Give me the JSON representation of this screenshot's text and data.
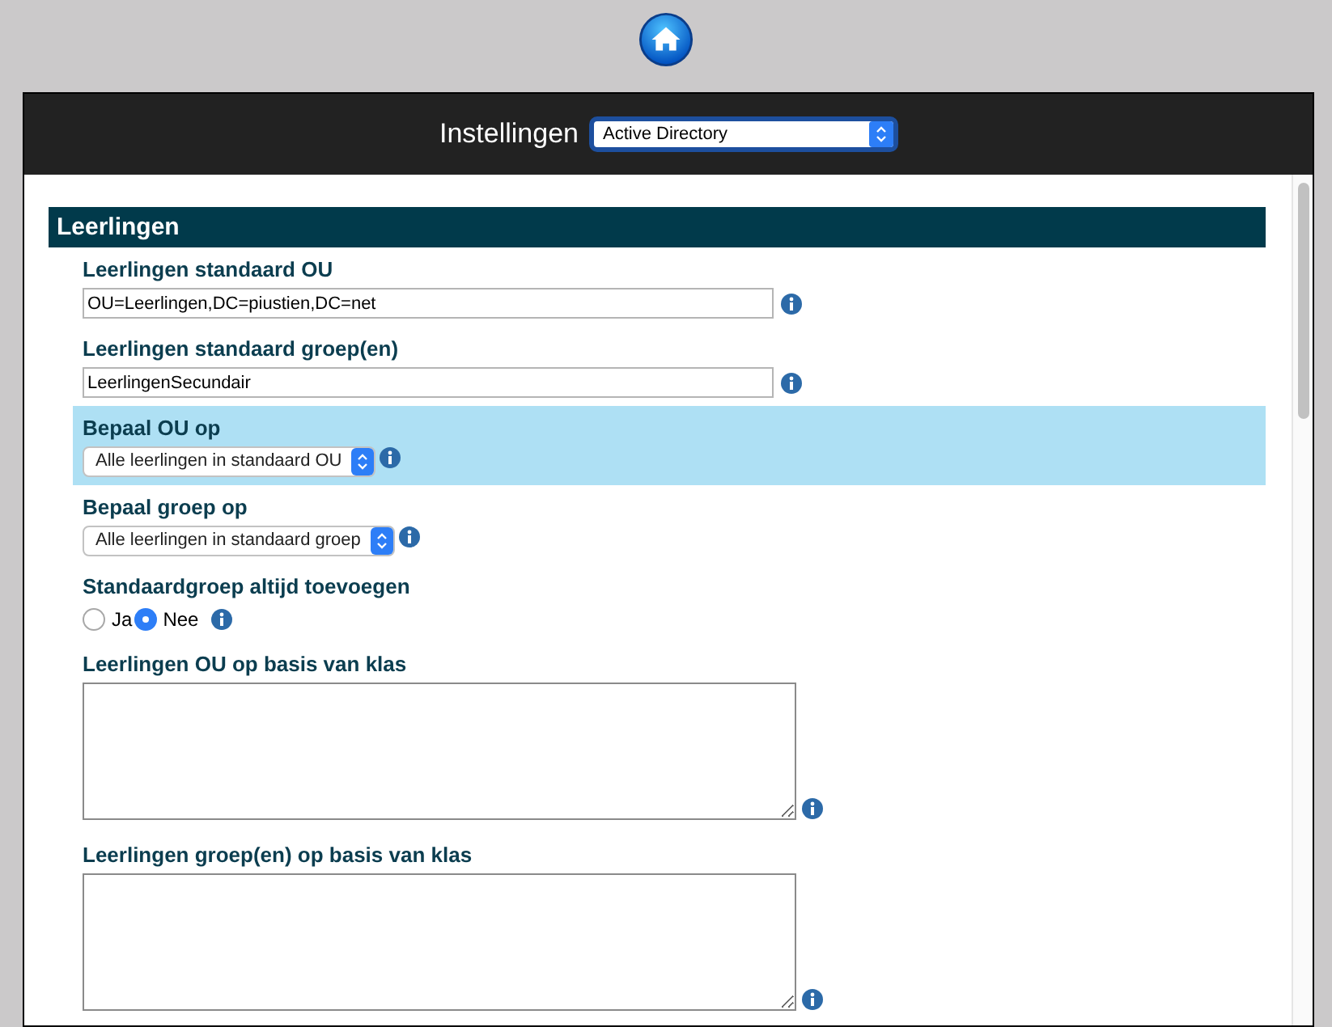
{
  "header": {
    "title": "Instellingen",
    "select_value": "Active Directory"
  },
  "section": {
    "title": "Leerlingen"
  },
  "fields": [
    {
      "kind": "text",
      "label": "Leerlingen standaard OU",
      "value": "OU=Leerlingen,DC=piustien,DC=net",
      "highlighted": false
    },
    {
      "kind": "text",
      "label": "Leerlingen standaard groep(en)",
      "value": "LeerlingenSecundair",
      "highlighted": false
    },
    {
      "kind": "select",
      "label": "Bepaal OU op",
      "value": "Alle leerlingen in standaard OU",
      "highlighted": true
    },
    {
      "kind": "select",
      "label": "Bepaal groep op",
      "value": "Alle leerlingen in standaard groep",
      "highlighted": false
    },
    {
      "kind": "radio",
      "label": "Standaardgroep altijd toevoegen",
      "highlighted": false,
      "options": [
        {
          "label": "Ja",
          "selected": false
        },
        {
          "label": "Nee",
          "selected": true
        }
      ]
    },
    {
      "kind": "textarea",
      "label": "Leerlingen OU op basis van klas",
      "highlighted": false
    },
    {
      "kind": "textarea",
      "label": "Leerlingen groep(en) op basis van klas",
      "highlighted": false
    }
  ]
}
